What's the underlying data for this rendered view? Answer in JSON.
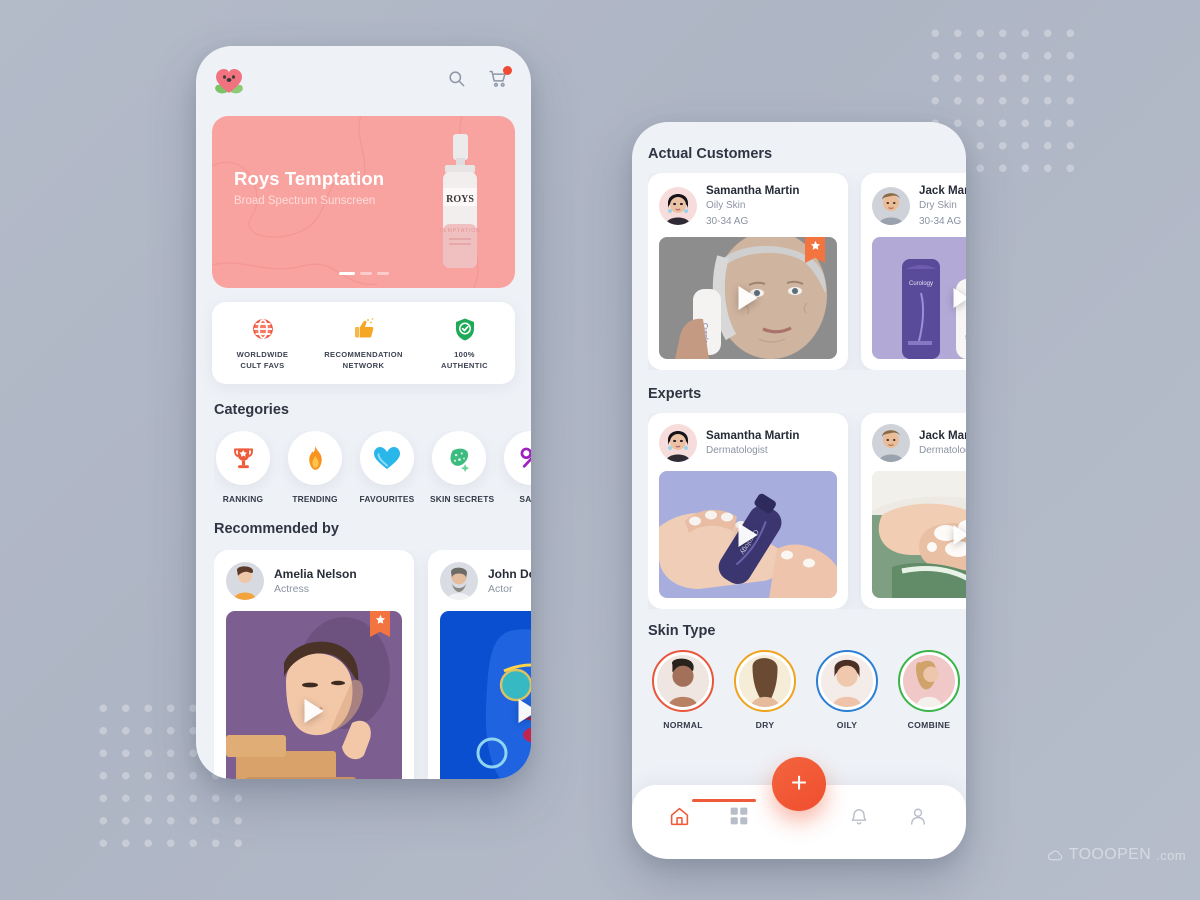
{
  "background": {
    "color": "#b2b9c7",
    "watermark": {
      "brand": "TOOOPEN",
      "suffix": ".com",
      "icon": "cloud-icon"
    }
  },
  "phone1": {
    "header": {
      "logo_name": "app-logo",
      "search_icon": "search-icon",
      "cart_icon": "cart-icon"
    },
    "banner": {
      "title": "Roys Temptation",
      "subtitle": "Broad Spectrum Sunscreen",
      "product_label": "ROYS",
      "product_sub": "TEMPTATION",
      "bg_color": "#f9a3a0",
      "slides": 3,
      "active_slide": 1
    },
    "features": [
      {
        "icon": "globe-icon",
        "line1": "WORLDWIDE",
        "line2": "CULT FAVS",
        "color": "#ee5a43"
      },
      {
        "icon": "thumbs-up-icon",
        "line1": "RECOMMENDATION",
        "line2": "NETWORK",
        "color": "#f5a623"
      },
      {
        "icon": "shield-check-icon",
        "line1": "100%",
        "line2": "AUTHENTIC",
        "color": "#1faa57"
      }
    ],
    "categories_title": "Categories",
    "categories": [
      {
        "label": "RANKING",
        "icon": "trophy-icon",
        "color": "#ef5b3a"
      },
      {
        "label": "TRENDING",
        "icon": "flame-icon",
        "color": "#f7931e"
      },
      {
        "label": "FAVOURITES",
        "icon": "heart-icon",
        "color": "#29b6e8"
      },
      {
        "label": "SKIN SECRETS",
        "icon": "sparkle-leaf-icon",
        "color": "#2bb673"
      },
      {
        "label": "SALE",
        "icon": "percent-icon",
        "color": "#a020c0"
      }
    ],
    "recommended_title": "Recommended by",
    "recommended": [
      {
        "name": "Amelia Nelson",
        "role": "Actress",
        "featured": true,
        "media": "woman-with-boxes-video"
      },
      {
        "name": "John Doe",
        "role": "Actor",
        "featured": false,
        "media": "neon-portrait-video"
      }
    ]
  },
  "phone2": {
    "customers_title": "Actual Customers",
    "customers": [
      {
        "name": "Samantha Martin",
        "skin": "Oily Skin",
        "age": "30-34 AG",
        "featured": true,
        "media": "elderly-woman-product-video"
      },
      {
        "name": "Jack Martin",
        "skin": "Dry Skin",
        "age": "30-34 AG",
        "featured": false,
        "media": "purple-tube-product-video"
      }
    ],
    "experts_title": "Experts",
    "experts": [
      {
        "name": "Samantha Martin",
        "role": "Dermatologist",
        "media": "hand-holding-tube-video"
      },
      {
        "name": "Jack Martin",
        "role": "Dermatologist",
        "media": "washing-hands-video"
      }
    ],
    "skin_type_title": "Skin Type",
    "skin_types": [
      {
        "label": "NORMAL",
        "ring": "#e8563b"
      },
      {
        "label": "DRY",
        "ring": "#f0a31c"
      },
      {
        "label": "OILY",
        "ring": "#2b7fd4"
      },
      {
        "label": "COMBINE",
        "ring": "#3bb44a"
      }
    ],
    "fab": {
      "label": "+",
      "color": "#ef5b3a",
      "name": "add-button"
    },
    "tabs": [
      {
        "name": "tab-home",
        "icon": "home-icon",
        "active": true
      },
      {
        "name": "tab-categories",
        "icon": "grid-icon",
        "active": false
      },
      {
        "name": "tab-notifications",
        "icon": "bell-icon",
        "active": false
      },
      {
        "name": "tab-profile",
        "icon": "user-icon",
        "active": false
      }
    ]
  }
}
